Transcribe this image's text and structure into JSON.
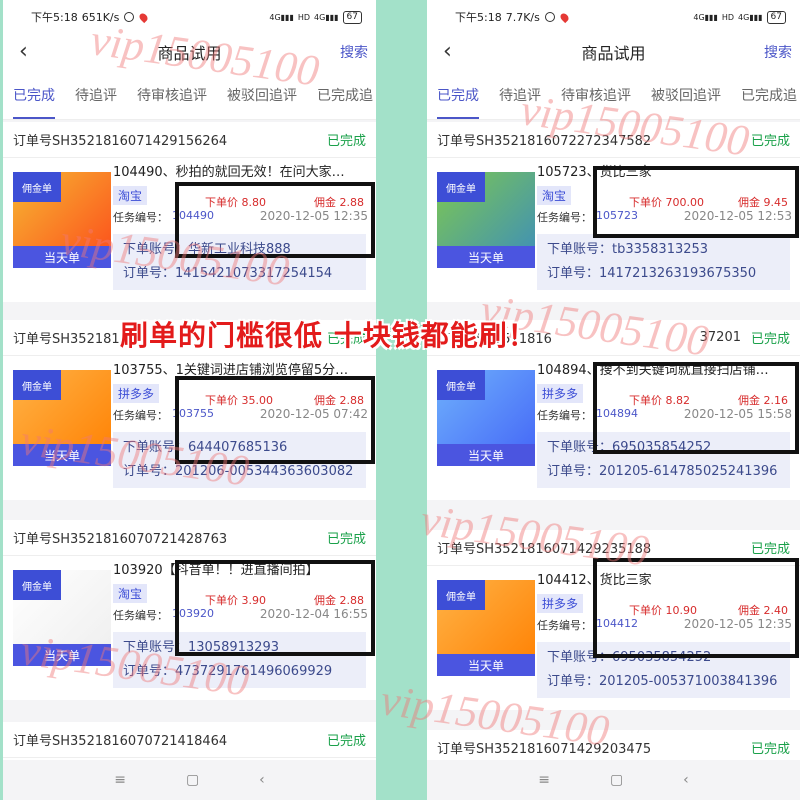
{
  "left": {
    "status": {
      "time": "下午5:18",
      "speed": "651K/s",
      "battery": "67"
    },
    "nav": {
      "title": "商品试用",
      "search": "搜索"
    },
    "tabs": [
      "已完成",
      "待追评",
      "待审核追评",
      "被驳回追评",
      "已完成追"
    ],
    "orders": [
      {
        "order_no": "订单号SH3521816071429156264",
        "status": "已完成",
        "id": "104490",
        "name": "104490、秒拍的就回无效！在问大家…",
        "platform": "淘宝",
        "price_label": "下单价 8.80",
        "commission": "佣金 2.88",
        "task_label": "任务编号：",
        "task_id": "104490",
        "date": "2020-12-05 12:35",
        "account": "下单账号：华新工业科技888",
        "order_line": "订单号：1415421073317254154",
        "tag": "佣金单",
        "bar": "当天单"
      },
      {
        "order_no": "订单号SH3521816",
        "status": "已完成",
        "id": "103755",
        "name": "103755、1关键词进店铺浏览停留5分…",
        "platform": "拼多多",
        "price_label": "下单价 35.00",
        "commission": "佣金 2.88",
        "task_label": "任务编号：",
        "task_id": "103755",
        "date": "2020-12-05 07:42",
        "account": "下单账号：644407685136",
        "order_line": "订单号：201206-005344363603082",
        "tag": "佣金单",
        "bar": "当天单"
      },
      {
        "order_no": "订单号SH3521816070721428763",
        "status": "已完成",
        "id": "103920",
        "name": "103920【抖音单！！进直播间拍】",
        "platform": "淘宝",
        "price_label": "下单价 3.90",
        "commission": "佣金 2.88",
        "task_label": "任务编号：",
        "task_id": "103920",
        "date": "2020-12-04 16:55",
        "account": "下单账号：13058913293",
        "order_line": "订单号：4737291761496069929",
        "tag": "佣金单",
        "bar": "当天单"
      },
      {
        "order_no": "订单号SH3521816070721418464",
        "status": "已完成"
      }
    ]
  },
  "right": {
    "status": {
      "time": "下午5:18",
      "speed": "7.7K/s",
      "battery": "67"
    },
    "nav": {
      "title": "商品试用",
      "search": "搜索"
    },
    "tabs": [
      "已完成",
      "待追评",
      "待审核追评",
      "被驳回追评",
      "已完成追"
    ],
    "orders": [
      {
        "order_no": "订单号SH3521816072272347582",
        "status": "已完成",
        "name": "105723、货比三家",
        "platform": "淘宝",
        "price_label": "下单价 700.00",
        "commission": "佣金 9.45",
        "task_label": "任务编号：",
        "task_id": "105723",
        "date": "2020-12-05 12:53",
        "account": "下单账号：tb3358313253",
        "order_line": "订单号：1417213263193675350",
        "tag": "佣金单",
        "bar": "当天单"
      },
      {
        "order_no": "订单号SH3521816",
        "order_suffix": "37201",
        "status": "已完成",
        "name": "104894、搜不到关键词就直接扫店铺…",
        "platform": "拼多多",
        "price_label": "下单价 8.82",
        "commission": "佣金 2.16",
        "task_label": "任务编号：",
        "task_id": "104894",
        "date": "2020-12-05 15:58",
        "account": "下单账号：695035854252",
        "order_line": "订单号：201205-614785025241396",
        "tag": "佣金单",
        "bar": "当天单"
      },
      {
        "order_no": "订单号SH3521816071429235188",
        "status": "已完成",
        "name": "104412、货比三家",
        "platform": "拼多多",
        "price_label": "下单价 10.90",
        "commission": "佣金 2.40",
        "task_label": "任务编号：",
        "task_id": "104412",
        "date": "2020-12-05 12:35",
        "account": "下单账号：695035854252",
        "order_line": "订单号：201205-005371003841396",
        "tag": "佣金单",
        "bar": "当天单"
      },
      {
        "order_no": "订单号SH3521816071429203475",
        "status": "已完成"
      }
    ]
  },
  "overlay_text": "刷单的门槛很低  十块钱都能刷！",
  "watermark": "vip15005100",
  "bottom_nav": [
    "≡",
    "▢",
    "‹"
  ],
  "colors": {
    "accent": "#4b56c8",
    "done": "#1aa14a",
    "price": "#d72c2c",
    "overlay": "#e31b1b",
    "bg": "#a3e1c9"
  }
}
